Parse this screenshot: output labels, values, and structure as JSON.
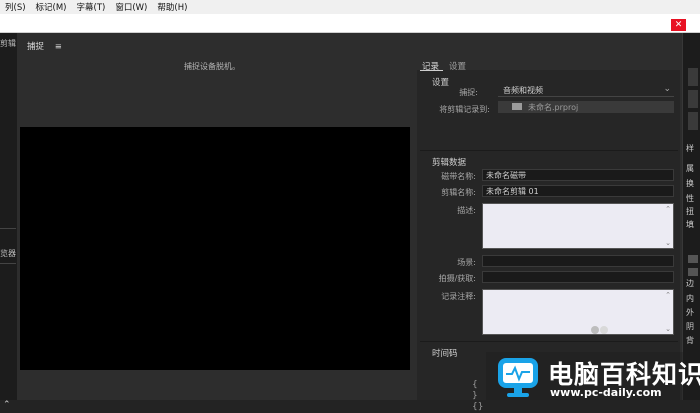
{
  "menubar": {
    "items": [
      "列(S)",
      "标记(M)",
      "字幕(T)",
      "窗口(W)",
      "帮助(H)"
    ]
  },
  "left_strip": {
    "labels": [
      "剪辑",
      "览器"
    ]
  },
  "right_strip": {
    "labels": [
      "样",
      "属",
      "换",
      "性",
      "扭",
      "填",
      "边",
      "内",
      "外",
      "阴",
      "背"
    ]
  },
  "panel": {
    "title": "捕捉",
    "menu_icon": "hamburger-icon",
    "status": "捕捉设备脱机。"
  },
  "tabs": [
    "记录",
    "设置"
  ],
  "settings": {
    "title": "设置",
    "capture_label": "捕捉:",
    "capture_value": "音频和视频",
    "log_clips_to_label": "将剪辑记录到:",
    "log_clips_to_value": "未命名.prproj"
  },
  "clip_data": {
    "title": "剪辑数据",
    "tape_name_label": "磁带名称:",
    "tape_name_value": "未命名磁带",
    "clip_name_label": "剪辑名称:",
    "clip_name_value": "未命名剪辑 01",
    "description_label": "描述:",
    "scene_label": "场景:",
    "shot_label": "拍摄/获取:",
    "log_note_label": "记录注释:"
  },
  "timecode": {
    "title": "时间码"
  },
  "watermark": {
    "title": "电脑百科知识",
    "url": "www.pc-daily.com"
  },
  "colors": {
    "accent_blue": "#1aa3e8",
    "close_red": "#e81123",
    "dialog_bg": "#2d2d2d"
  }
}
